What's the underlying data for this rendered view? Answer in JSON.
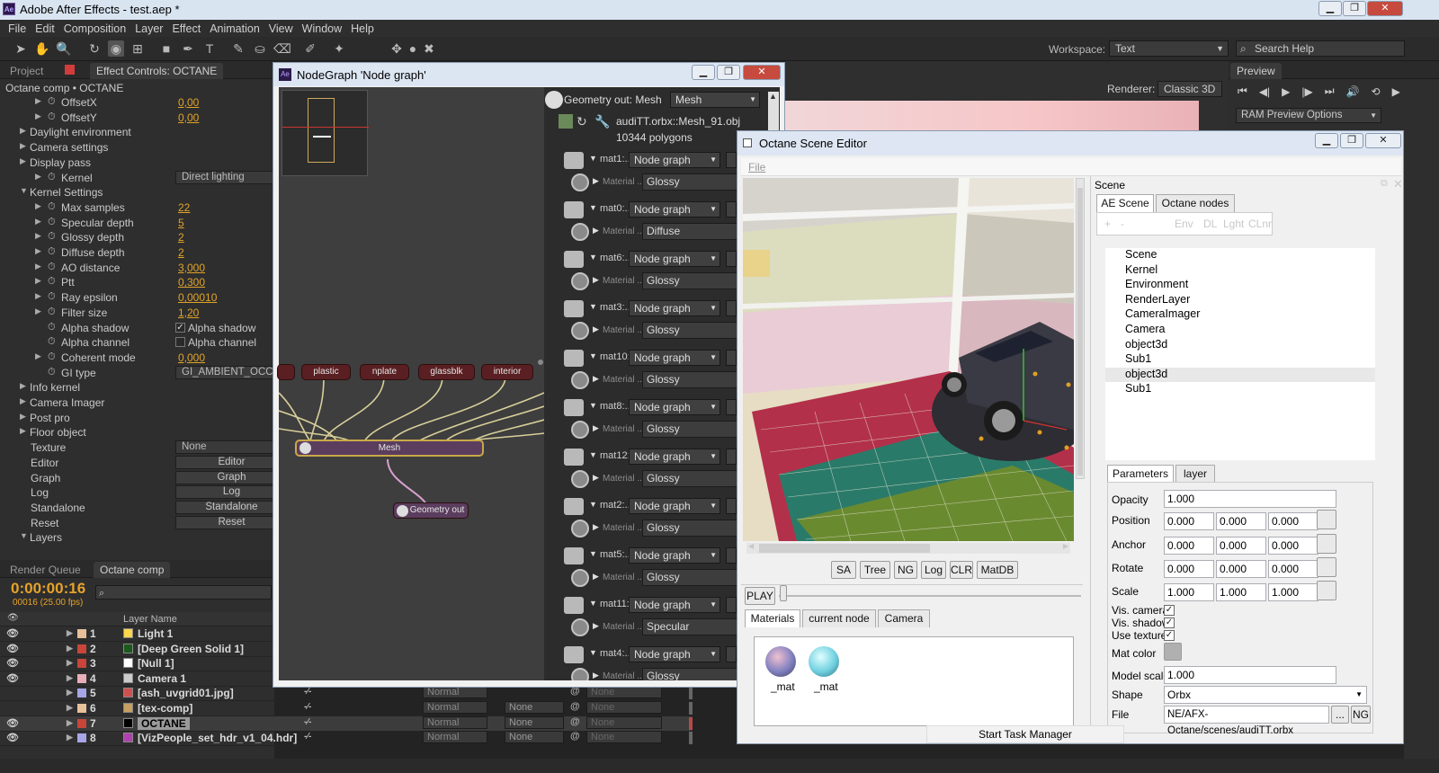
{
  "app": {
    "title": "Adobe After Effects - test.aep *",
    "logo": "Ae"
  },
  "menu": [
    "File",
    "Edit",
    "Composition",
    "Layer",
    "Effect",
    "Animation",
    "View",
    "Window",
    "Help"
  ],
  "workspace": {
    "label": "Workspace:",
    "value": "Text",
    "search_placeholder": "Search Help"
  },
  "panels": {
    "project_tab": "Project",
    "effect_tab": "Effect Controls: OCTANE",
    "comp_label": "Octane comp • OCTANE",
    "renderer_label": "Renderer:",
    "renderer_value": "Classic 3D",
    "preview_tab": "Preview",
    "ram_preview": "RAM Preview Options"
  },
  "effect_rows": [
    {
      "t": "OffsetX",
      "v": "0,00",
      "ind": 2
    },
    {
      "t": "OffsetY",
      "v": "0,00",
      "ind": 2
    },
    {
      "t": "Daylight environment",
      "ind": 1
    },
    {
      "t": "Camera settings",
      "ind": 1
    },
    {
      "t": "Display pass",
      "ind": 1
    },
    {
      "t": "Kernel",
      "ind": 2,
      "d": "Direct lighting"
    },
    {
      "t": "Kernel Settings",
      "ind": 1,
      "open": true
    },
    {
      "t": "Max samples",
      "v": "22",
      "ind": 2
    },
    {
      "t": "Specular depth",
      "v": "5",
      "ind": 2
    },
    {
      "t": "Glossy depth",
      "v": "2",
      "ind": 2
    },
    {
      "t": "Diffuse depth",
      "v": "2",
      "ind": 2
    },
    {
      "t": "AO distance",
      "v": "3,000",
      "ind": 2
    },
    {
      "t": "Ptt",
      "v": "0,300",
      "ind": 2
    },
    {
      "t": "Ray epsilon",
      "v": "0,00010",
      "ind": 2
    },
    {
      "t": "Filter size",
      "v": "1,20",
      "ind": 2
    },
    {
      "t": "Alpha shadow",
      "ind": 3,
      "c": "Alpha shadow",
      "checked": true
    },
    {
      "t": "Alpha channel",
      "ind": 3,
      "c": "Alpha channel",
      "checked": false
    },
    {
      "t": "Coherent mode",
      "v": "0,000",
      "ind": 2
    },
    {
      "t": "GI type",
      "ind": 3,
      "d": "GI_AMBIENT_OCCLU"
    },
    {
      "t": "Info kernel",
      "ind": 1
    },
    {
      "t": "Camera Imager",
      "ind": 1
    },
    {
      "t": "Post pro",
      "ind": 1
    },
    {
      "t": "Floor object",
      "ind": 1
    },
    {
      "t": "Texture",
      "ind": 0,
      "d": "None"
    },
    {
      "t": "Editor",
      "ind": 0,
      "b": "Editor"
    },
    {
      "t": "Graph",
      "ind": 0,
      "b": "Graph"
    },
    {
      "t": "Log",
      "ind": 0,
      "b": "Log"
    },
    {
      "t": "Standalone",
      "ind": 0,
      "b": "Standalone"
    },
    {
      "t": "Reset",
      "ind": 0,
      "b": "Reset"
    },
    {
      "t": "Layers",
      "ind": 1,
      "open": true
    }
  ],
  "timeline": {
    "tab1": "Render Queue",
    "tab2": "Octane comp",
    "time": "0:00:00:16",
    "fps": "00016 (25.00 fps)",
    "col_layer": "Layer Name",
    "layers": [
      {
        "n": "1",
        "name": "Light 1",
        "c": "#e7c19a",
        "icon": "#ffd74a",
        "eye": true
      },
      {
        "n": "2",
        "name": "[Deep Green Solid 1]",
        "c": "#c9453a",
        "icon": "#1a5a1a",
        "eye": true
      },
      {
        "n": "3",
        "name": "[Null 1]",
        "c": "#c9453a",
        "icon": "#ffffff",
        "eye": true
      },
      {
        "n": "4",
        "name": "Camera 1",
        "c": "#e9aeb8",
        "icon": "#cccccc",
        "eye": true
      },
      {
        "n": "5",
        "name": "[ash_uvgrid01.jpg]",
        "c": "#a6a6e6",
        "icon": "#d05050",
        "eye": false
      },
      {
        "n": "6",
        "name": "[tex-comp]",
        "c": "#e7c19a",
        "icon": "#c9a060",
        "eye": false
      },
      {
        "n": "7",
        "name": "OCTANE",
        "c": "#c9453a",
        "icon": "#000000",
        "eye": true
      },
      {
        "n": "8",
        "name": "[VizPeople_set_hdr_v1_04.hdr]",
        "c": "#a6a6e6",
        "icon": "#b040b0",
        "eye": true
      }
    ],
    "mode": "Normal",
    "trk": "None",
    "parent": "None"
  },
  "nodegraph": {
    "title": "NodeGraph 'Node graph'",
    "nodes": [
      "plastic",
      "nplate",
      "glassblk",
      "interior"
    ],
    "mesh": "Mesh",
    "geo_out": "Geometry out",
    "header": {
      "label": "Geometry out: Mesh",
      "value": "Mesh",
      "file": "audiTT.orbx::Mesh_91.obj",
      "polys": "10344 polygons"
    },
    "materials": [
      {
        "m": "mat1:...",
        "t": "Glossy"
      },
      {
        "m": "mat0:...",
        "t": "Diffuse"
      },
      {
        "m": "mat6:...",
        "t": "Glossy"
      },
      {
        "m": "mat3:...",
        "t": "Glossy"
      },
      {
        "m": "mat10:...",
        "t": "Glossy"
      },
      {
        "m": "mat8:...",
        "t": "Glossy"
      },
      {
        "m": "mat12:...",
        "t": "Glossy"
      },
      {
        "m": "mat2:...",
        "t": "Glossy"
      },
      {
        "m": "mat5:...",
        "t": "Glossy"
      },
      {
        "m": "mat11:...",
        "t": "Specular"
      },
      {
        "m": "mat4:...",
        "t": "Glossy"
      }
    ],
    "ng_value": "Node graph",
    "mat_label": "Material ..."
  },
  "ose": {
    "title": "Octane Scene Editor",
    "file_menu": "File",
    "buttons": [
      "SA",
      "Tree",
      "NG",
      "Log",
      "CLR",
      "MatDB"
    ],
    "play": "PLAY",
    "tabs": [
      "Materials",
      "current node",
      "Camera"
    ],
    "mat_items": [
      "_mat",
      "_mat"
    ],
    "scene_label": "Scene",
    "scene_tabs": [
      "AE Scene",
      "Octane nodes"
    ],
    "scene_btns": [
      "+",
      "-",
      "Env",
      "DL",
      "Lght",
      "CLnr"
    ],
    "tree": [
      "Scene",
      "Kernel",
      "Environment",
      "RenderLayer",
      "CameraImager",
      "Camera",
      "object3d",
      "Sub1",
      "object3d",
      "Sub1"
    ],
    "param_tabs": [
      "Parameters",
      "layer"
    ],
    "params": {
      "opacity_l": "Opacity",
      "opacity": "1.000",
      "position_l": "Position",
      "position": [
        "0.000",
        "0.000",
        "0.000"
      ],
      "anchor_l": "Anchor",
      "anchor": [
        "0.000",
        "0.000",
        "0.000"
      ],
      "rotate_l": "Rotate",
      "rotate": [
        "0.000",
        "0.000",
        "0.000"
      ],
      "scale_l": "Scale",
      "scale": [
        "1.000",
        "1.000",
        "1.000"
      ],
      "vis_camera": "Vis. camera",
      "vis_shadow": "Vis. shadow",
      "use_texture": "Use texture",
      "mat_color": "Mat color",
      "model_scale_l": "Model scale",
      "model_scale": "1.000",
      "shape_l": "Shape",
      "shape": "Orbx",
      "file_l": "File",
      "file": "NE/AFX-Octane/scenes/audiTT.orbx",
      "dots": "...",
      "ng": "NG"
    },
    "task": "Start Task Manager"
  }
}
